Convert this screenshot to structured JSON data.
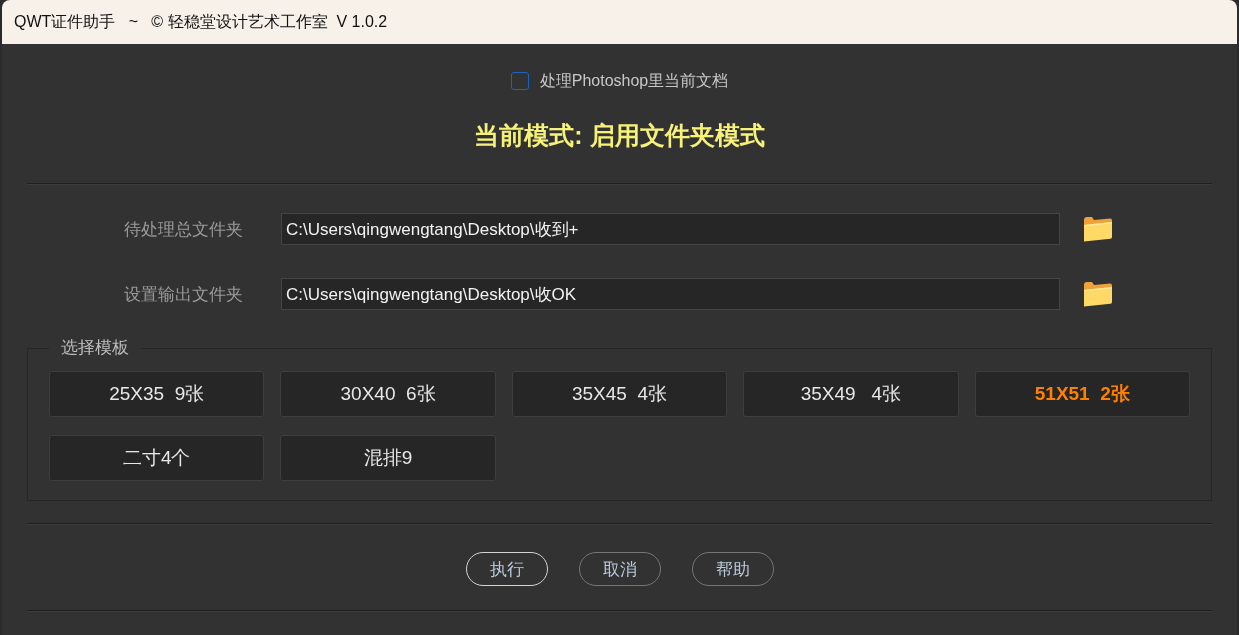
{
  "window": {
    "title": "QWT证件助手   ~   © 轻稳堂设计艺术工作室  V 1.0.2"
  },
  "photoshop_option": {
    "label": "处理Photoshop里当前文档",
    "checked": false
  },
  "mode": {
    "text": "当前模式: 启用文件夹模式"
  },
  "folders": [
    {
      "label": "待处理总文件夹",
      "value": "C:\\Users\\qingwengtang\\Desktop\\收到+"
    },
    {
      "label": "设置输出文件夹",
      "value": "C:\\Users\\qingwengtang\\Desktop\\收OK"
    }
  ],
  "templates": {
    "title": "选择模板",
    "buttons": [
      {
        "label": "25X35  9张",
        "selected": false
      },
      {
        "label": "30X40  6张",
        "selected": false
      },
      {
        "label": "35X45  4张",
        "selected": false
      },
      {
        "label": "35X49   4张",
        "selected": false
      },
      {
        "label": "51X51  2张",
        "selected": true
      },
      {
        "label": "二寸4个",
        "selected": false
      },
      {
        "label": "混排9",
        "selected": false
      }
    ]
  },
  "actions": [
    {
      "label": "执行",
      "default": true
    },
    {
      "label": "取消",
      "default": false
    },
    {
      "label": "帮助",
      "default": false
    }
  ]
}
